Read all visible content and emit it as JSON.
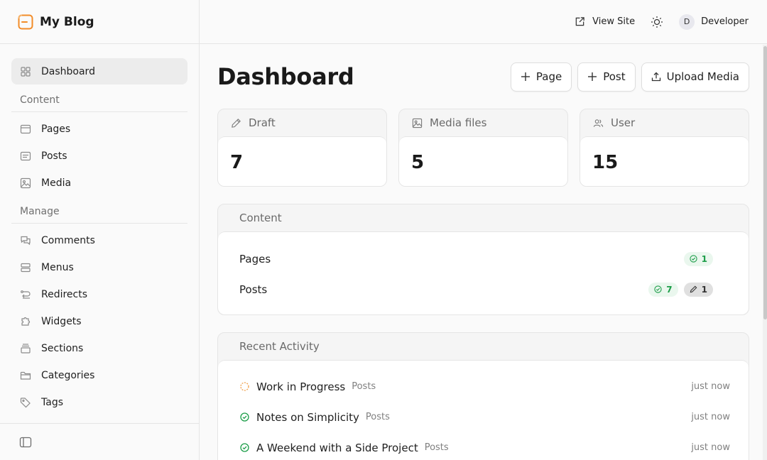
{
  "brand": {
    "name": "My Blog",
    "accent": "#f28c28"
  },
  "sidebar": {
    "dashboard": {
      "label": "Dashboard",
      "icon": "grid-icon"
    },
    "content_group": "Content",
    "content_items": [
      {
        "label": "Pages",
        "icon": "page-icon"
      },
      {
        "label": "Posts",
        "icon": "post-icon"
      },
      {
        "label": "Media",
        "icon": "image-icon"
      }
    ],
    "manage_group": "Manage",
    "manage_items": [
      {
        "label": "Comments",
        "icon": "comments-icon"
      },
      {
        "label": "Menus",
        "icon": "menu-icon"
      },
      {
        "label": "Redirects",
        "icon": "redirect-icon"
      },
      {
        "label": "Widgets",
        "icon": "puzzle-icon"
      },
      {
        "label": "Sections",
        "icon": "sections-icon"
      },
      {
        "label": "Categories",
        "icon": "folder-icon"
      },
      {
        "label": "Tags",
        "icon": "tag-icon"
      }
    ]
  },
  "topbar": {
    "view_site": "View Site",
    "avatar_initial": "D",
    "user": "Developer"
  },
  "main": {
    "title": "Dashboard",
    "actions": {
      "page": "Page",
      "post": "Post",
      "upload": "Upload Media"
    },
    "stats": [
      {
        "label": "Draft",
        "value": "7",
        "icon": "pencil-icon"
      },
      {
        "label": "Media files",
        "value": "5",
        "icon": "image-icon"
      },
      {
        "label": "User",
        "value": "15",
        "icon": "users-icon"
      }
    ],
    "content_card": {
      "title": "Content",
      "rows": [
        {
          "label": "Pages",
          "published": "1"
        },
        {
          "label": "Posts",
          "published": "7",
          "drafts": "1"
        }
      ]
    },
    "activity_card": {
      "title": "Recent Activity",
      "items": [
        {
          "title": "Work in Progress",
          "type": "Posts",
          "time": "just now",
          "status": "draft"
        },
        {
          "title": "Notes on Simplicity",
          "type": "Posts",
          "time": "just now",
          "status": "published"
        },
        {
          "title": "A Weekend with a Side Project",
          "type": "Posts",
          "time": "just now",
          "status": "published"
        }
      ]
    }
  },
  "colors": {
    "success": "#1e9e4a",
    "draft_ring": "#f0a04b"
  }
}
